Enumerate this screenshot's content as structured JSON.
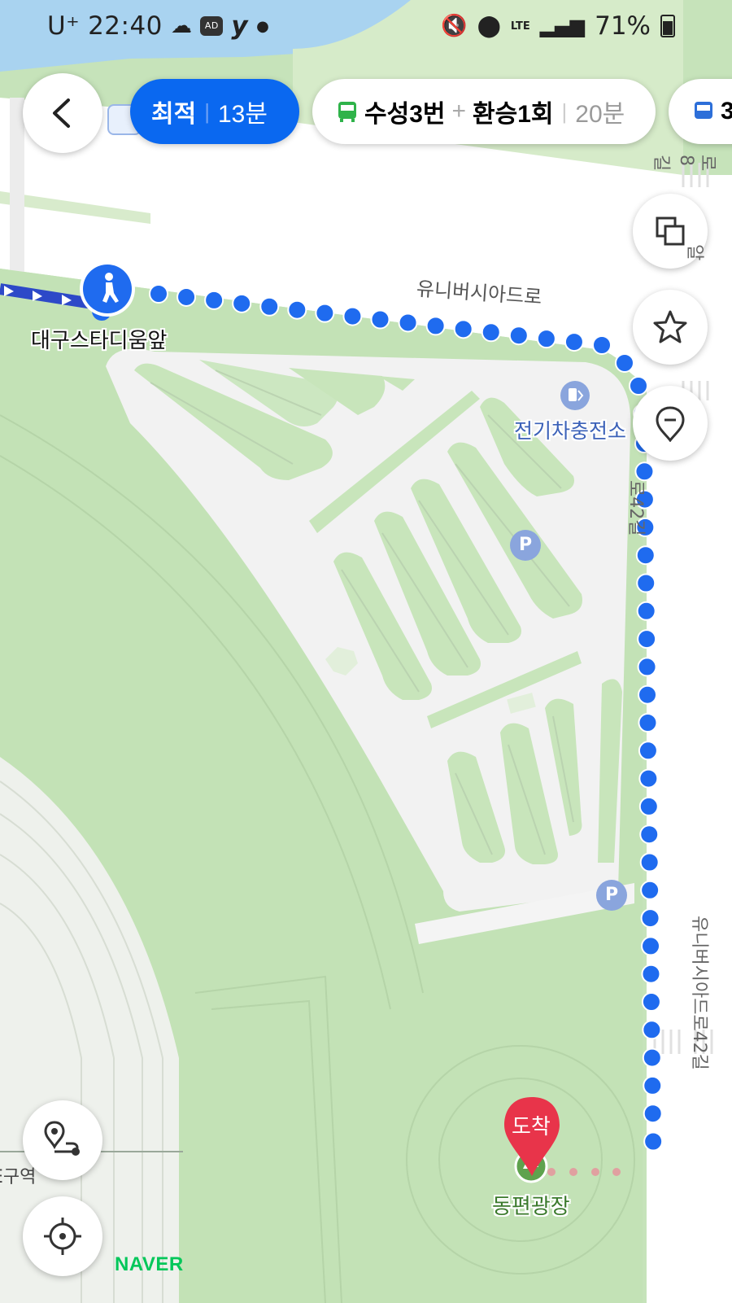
{
  "status_bar": {
    "carrier": "U⁺",
    "time": "22:40",
    "network": "LTE",
    "battery": "71%"
  },
  "route_options": [
    {
      "label": "최적",
      "time": "13분"
    },
    {
      "label": "수성3번",
      "plus": "+",
      "transfer": "환승1회",
      "time": "20분"
    },
    {
      "label": "3"
    }
  ],
  "map": {
    "start_label": "대구스타디움앞",
    "road_label_top": "유니버시아드로",
    "ev_label": "전기차충전소",
    "road_42gil_upper": "로42길",
    "road_42gil_lower": "유니버시아드로42길",
    "road_8gil": "로8길",
    "road_side_frag": "알",
    "arrival_pin_label": "도착",
    "destination_label": "동편광장",
    "left_frag": "E구역",
    "parking_symbol": "P",
    "logo": "NAVER"
  },
  "colors": {
    "route_blue": "#1f6bef",
    "brand_green": "#03c75a",
    "arrival_red": "#e8344a"
  },
  "icons": [
    "back-arrow-icon",
    "bus-icon",
    "layers-icon",
    "star-icon",
    "location-pin-icon",
    "route-icon",
    "current-location-icon",
    "walk-icon",
    "ev-charger-icon",
    "parking-icon",
    "park-icon",
    "arrival-pin"
  ]
}
